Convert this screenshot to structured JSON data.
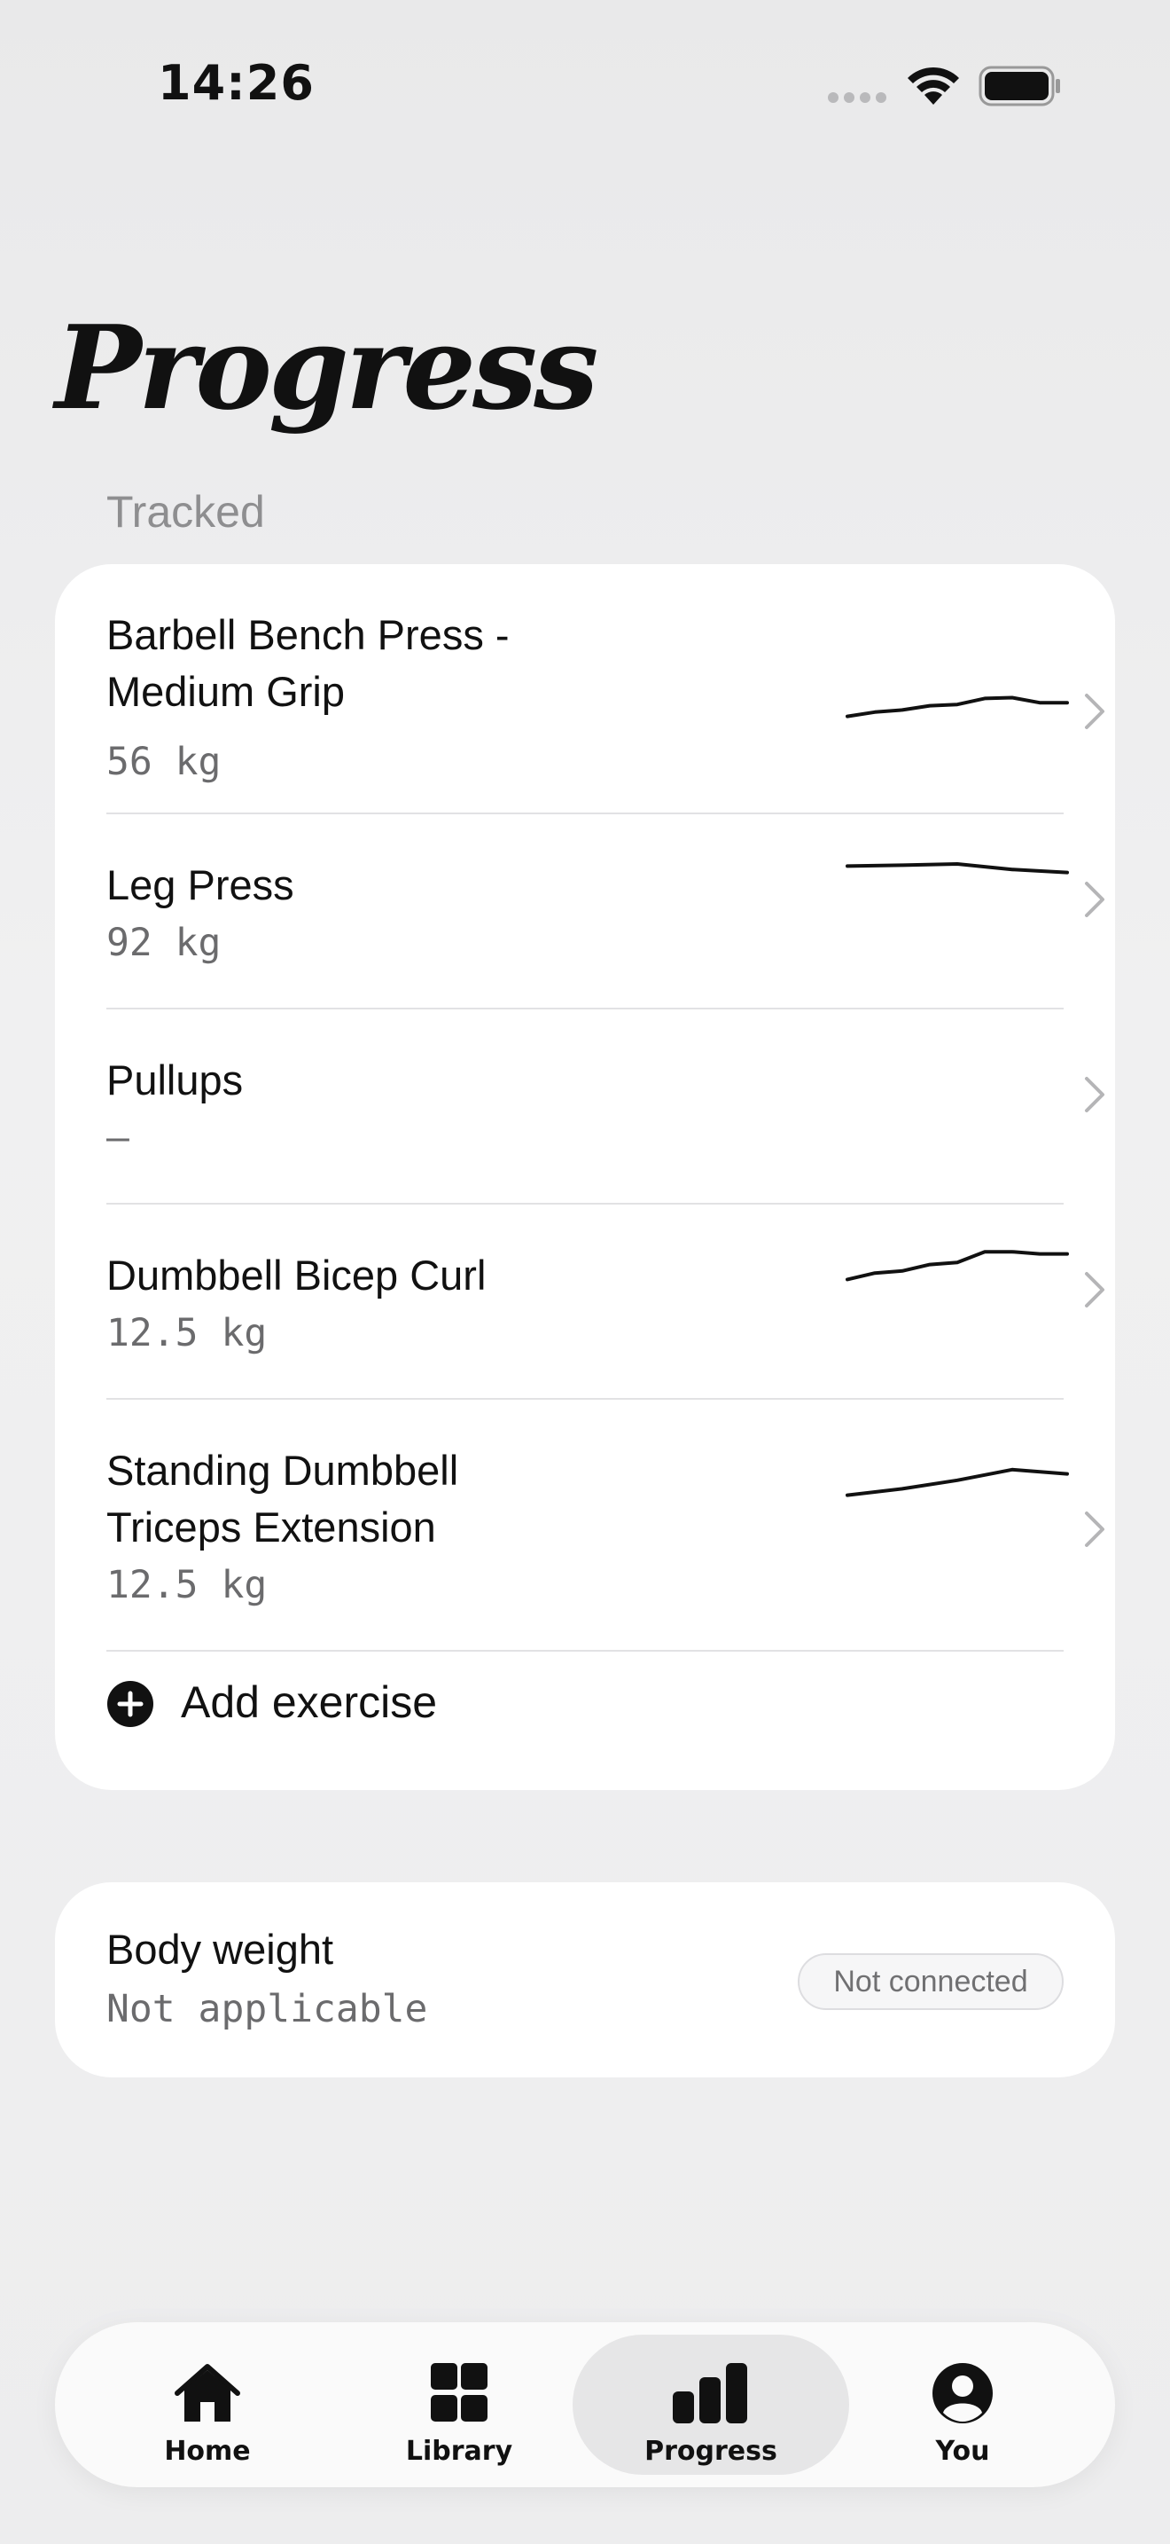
{
  "status_bar": {
    "time": "14:26"
  },
  "header": {
    "title": "Progress"
  },
  "tracked": {
    "section_label": "Tracked",
    "exercises": [
      {
        "name": "Barbell Bench Press - Medium Grip",
        "value": "56 kg",
        "trend": [
          0.3,
          0.4,
          0.45,
          0.55,
          0.58,
          0.72,
          0.74,
          0.62,
          0.62
        ]
      },
      {
        "name": "Leg Press",
        "value": "92 kg",
        "trend": [
          0.7,
          0.72,
          0.75,
          0.62,
          0.55
        ]
      },
      {
        "name": "Pullups",
        "value": "–",
        "trend": []
      },
      {
        "name": "Dumbbell Bicep Curl",
        "value": "12.5 kg",
        "trend": [
          0.2,
          0.35,
          0.4,
          0.55,
          0.6,
          0.85,
          0.85,
          0.8,
          0.8
        ]
      },
      {
        "name": "Standing Dumbbell Triceps Extension",
        "value": "12.5 kg",
        "trend": [
          0.3,
          0.45,
          0.65,
          0.9,
          0.8
        ]
      }
    ],
    "add_label": "Add exercise"
  },
  "body_weight": {
    "title": "Body weight",
    "value": "Not applicable",
    "badge": "Not connected"
  },
  "tab_bar": {
    "tabs": [
      {
        "label": "Home",
        "icon": "home-icon",
        "active": false
      },
      {
        "label": "Library",
        "icon": "grid-icon",
        "active": false
      },
      {
        "label": "Progress",
        "icon": "bar-chart-icon",
        "active": true
      },
      {
        "label": "You",
        "icon": "user-icon",
        "active": false
      }
    ]
  }
}
